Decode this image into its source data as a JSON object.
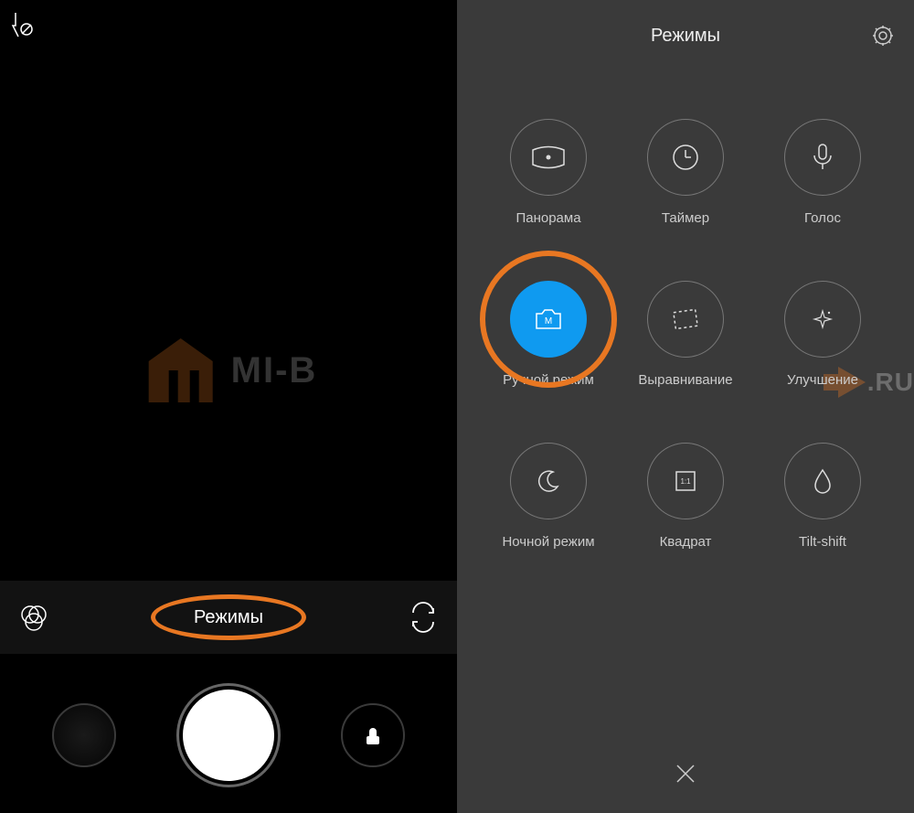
{
  "left": {
    "modes_label": "Режимы",
    "watermark_text": "MI-B"
  },
  "right": {
    "title": "Режимы",
    "modes": [
      {
        "label": "Панорама"
      },
      {
        "label": "Таймер"
      },
      {
        "label": "Голос"
      },
      {
        "label": "Ручной режим"
      },
      {
        "label": "Выравнивание"
      },
      {
        "label": "Улучшение"
      },
      {
        "label": "Ночной режим"
      },
      {
        "label": "Квадрат"
      },
      {
        "label": "Tilt-shift"
      }
    ],
    "watermark_ru": ".RU"
  }
}
